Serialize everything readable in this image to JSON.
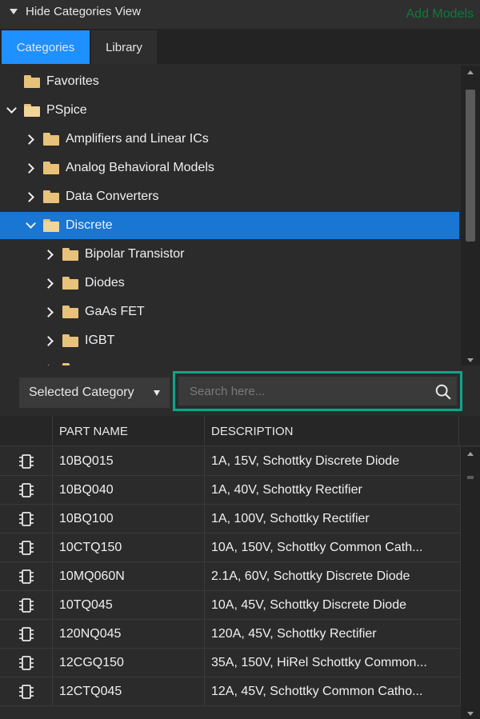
{
  "header": {
    "hide_label": "Hide Categories View",
    "add_models": "Add Models"
  },
  "tabs": [
    {
      "label": "Categories",
      "active": true
    },
    {
      "label": "Library",
      "active": false
    }
  ],
  "tree": [
    {
      "label": "Favorites",
      "depth": 0,
      "expander": "none",
      "open": false
    },
    {
      "label": "PSpice",
      "depth": 0,
      "expander": "down",
      "open": true
    },
    {
      "label": "Amplifiers and Linear ICs",
      "depth": 1,
      "expander": "right",
      "open": false
    },
    {
      "label": "Analog Behavioral Models",
      "depth": 1,
      "expander": "right",
      "open": false
    },
    {
      "label": "Data Converters",
      "depth": 1,
      "expander": "right",
      "open": false
    },
    {
      "label": "Discrete",
      "depth": 1,
      "expander": "down",
      "open": true,
      "selected": true
    },
    {
      "label": "Bipolar Transistor",
      "depth": 2,
      "expander": "right",
      "open": false
    },
    {
      "label": "Diodes",
      "depth": 2,
      "expander": "right",
      "open": false
    },
    {
      "label": "GaAs FET",
      "depth": 2,
      "expander": "right",
      "open": false
    },
    {
      "label": "IGBT",
      "depth": 2,
      "expander": "right",
      "open": false
    },
    {
      "label": "",
      "depth": 2,
      "expander": "right",
      "open": false
    }
  ],
  "filter": {
    "category_value": "Selected Category",
    "search_placeholder": "Search here..."
  },
  "table": {
    "headers": [
      "PART NAME",
      "DESCRIPTION"
    ],
    "rows": [
      {
        "name": "10BQ015",
        "description": "1A, 15V, Schottky Discrete Diode"
      },
      {
        "name": "10BQ040",
        "description": "1A, 40V, Schottky Rectifier"
      },
      {
        "name": "10BQ100",
        "description": "1A, 100V, Schottky Rectifier"
      },
      {
        "name": "10CTQ150",
        "description": "10A, 150V, Schottky Common Cath..."
      },
      {
        "name": "10MQ060N",
        "description": "2.1A, 60V, Schottky Discrete Diode"
      },
      {
        "name": "10TQ045",
        "description": "10A, 45V, Schottky Discrete Diode"
      },
      {
        "name": "120NQ045",
        "description": "120A, 45V, Schottky Rectifier"
      },
      {
        "name": "12CGQ150",
        "description": "35A, 150V, HiRel Schottky Common..."
      },
      {
        "name": "12CTQ045",
        "description": "12A, 45V, Schottky Common Catho..."
      }
    ]
  },
  "colors": {
    "accent": "#1e90ff",
    "selected_row": "#1976d2",
    "search_highlight": "#0ea58a",
    "add_models": "#0d7a3a"
  }
}
